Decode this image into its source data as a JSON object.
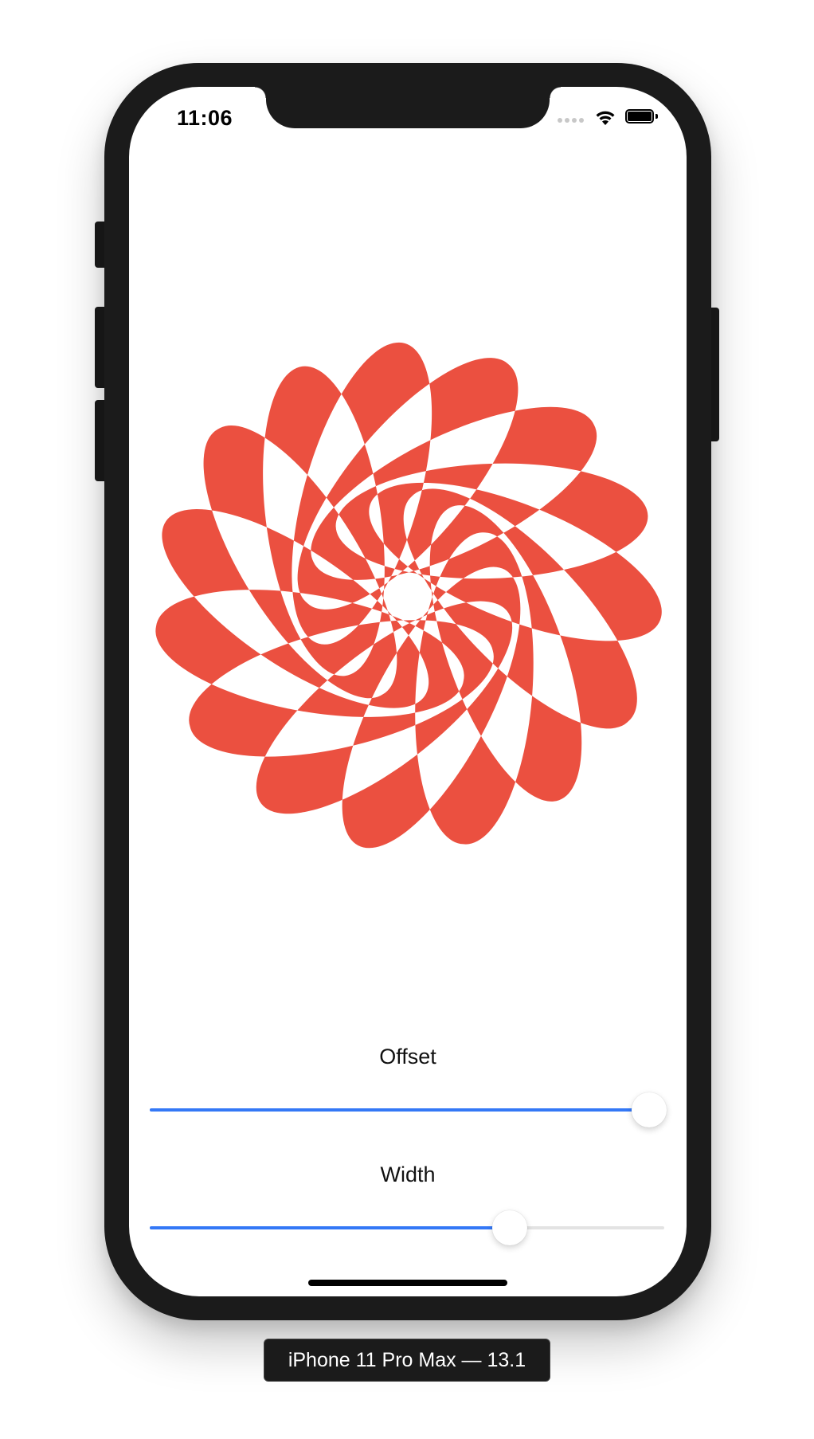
{
  "status_bar": {
    "time": "11:06"
  },
  "colors": {
    "petal": "#eb5040",
    "accent": "#3478f6"
  },
  "flower": {
    "petal_count": 15
  },
  "controls": {
    "offset": {
      "label": "Offset",
      "value_fraction": 0.97
    },
    "width": {
      "label": "Width",
      "value_fraction": 0.7
    }
  },
  "simulator": {
    "device_label": "iPhone 11 Pro Max — 13.1"
  }
}
